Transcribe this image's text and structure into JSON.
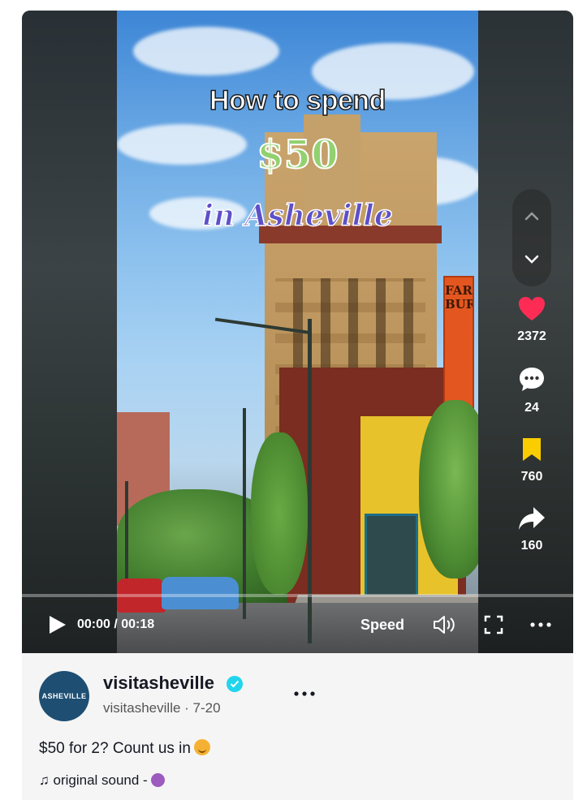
{
  "video": {
    "overlay_line1": "How to spend",
    "overlay_line2": "$50",
    "overlay_line3": "in Asheville",
    "sign_text": "FARM BURG"
  },
  "actions": {
    "likes": "2372",
    "comments": "24",
    "saves": "760",
    "shares": "160"
  },
  "controls": {
    "time": "00:00 / 00:18",
    "speed_label": "Speed",
    "progress": 0
  },
  "post": {
    "avatar_text": "ASHEVILLE",
    "username": "visitasheville",
    "handle_date": "visitasheville · 7-20",
    "caption": "$50 for 2? Count us in",
    "sound": "original sound -"
  },
  "colors": {
    "like": "#fe2c55",
    "save": "#facd00",
    "verified": "#20d5ec"
  },
  "icons": [
    "chevron-up-icon",
    "chevron-down-icon",
    "heart-icon",
    "comment-icon",
    "bookmark-icon",
    "share-icon",
    "play-icon",
    "volume-icon",
    "fullscreen-icon",
    "more-icon",
    "verified-icon",
    "music-note-icon"
  ]
}
